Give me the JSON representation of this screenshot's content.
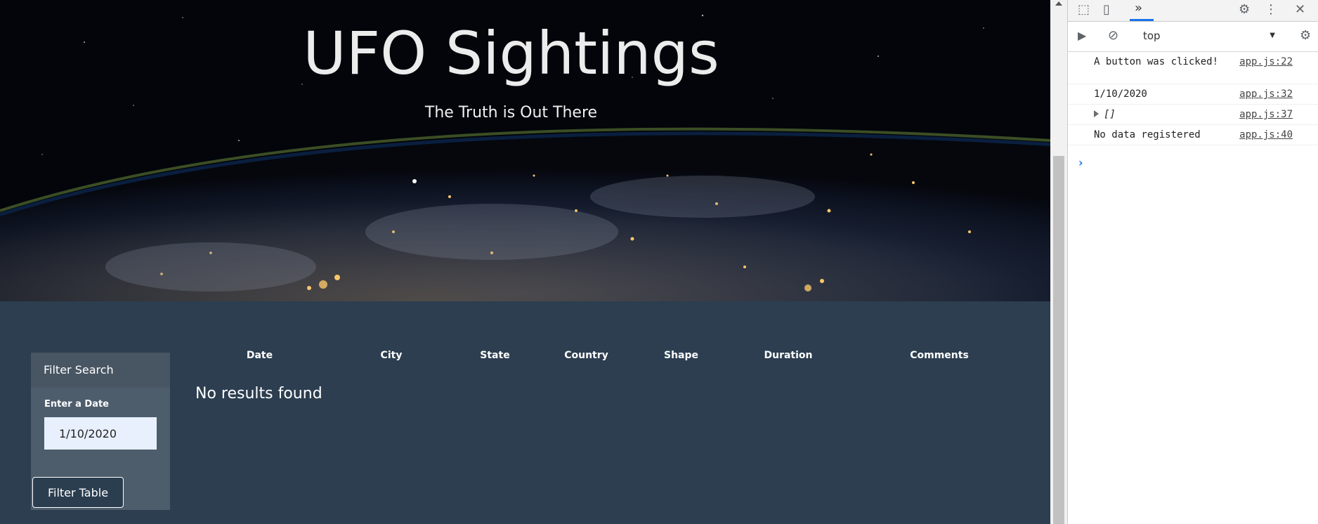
{
  "hero": {
    "title": "UFO Sightings",
    "subtitle": "The Truth is Out There"
  },
  "filter": {
    "heading": "Filter Search",
    "date_label": "Enter a Date",
    "date_value": "1/10/2020",
    "button_label": "Filter Table"
  },
  "table": {
    "columns": [
      "Date",
      "City",
      "State",
      "Country",
      "Shape",
      "Duration",
      "Comments"
    ],
    "empty_message": "No results found"
  },
  "devtools": {
    "context": "top",
    "console": [
      {
        "message": "A button was clicked!",
        "source": "app.js:22"
      },
      {
        "message": "1/10/2020",
        "source": "app.js:32"
      },
      {
        "message": "[]",
        "source": "app.js:37"
      },
      {
        "message": "No data registered",
        "source": "app.js:40"
      }
    ]
  },
  "colors": {
    "page_background": "#2c3e50",
    "panel": "#4e5d6c",
    "input_background": "#e8f0fe"
  }
}
